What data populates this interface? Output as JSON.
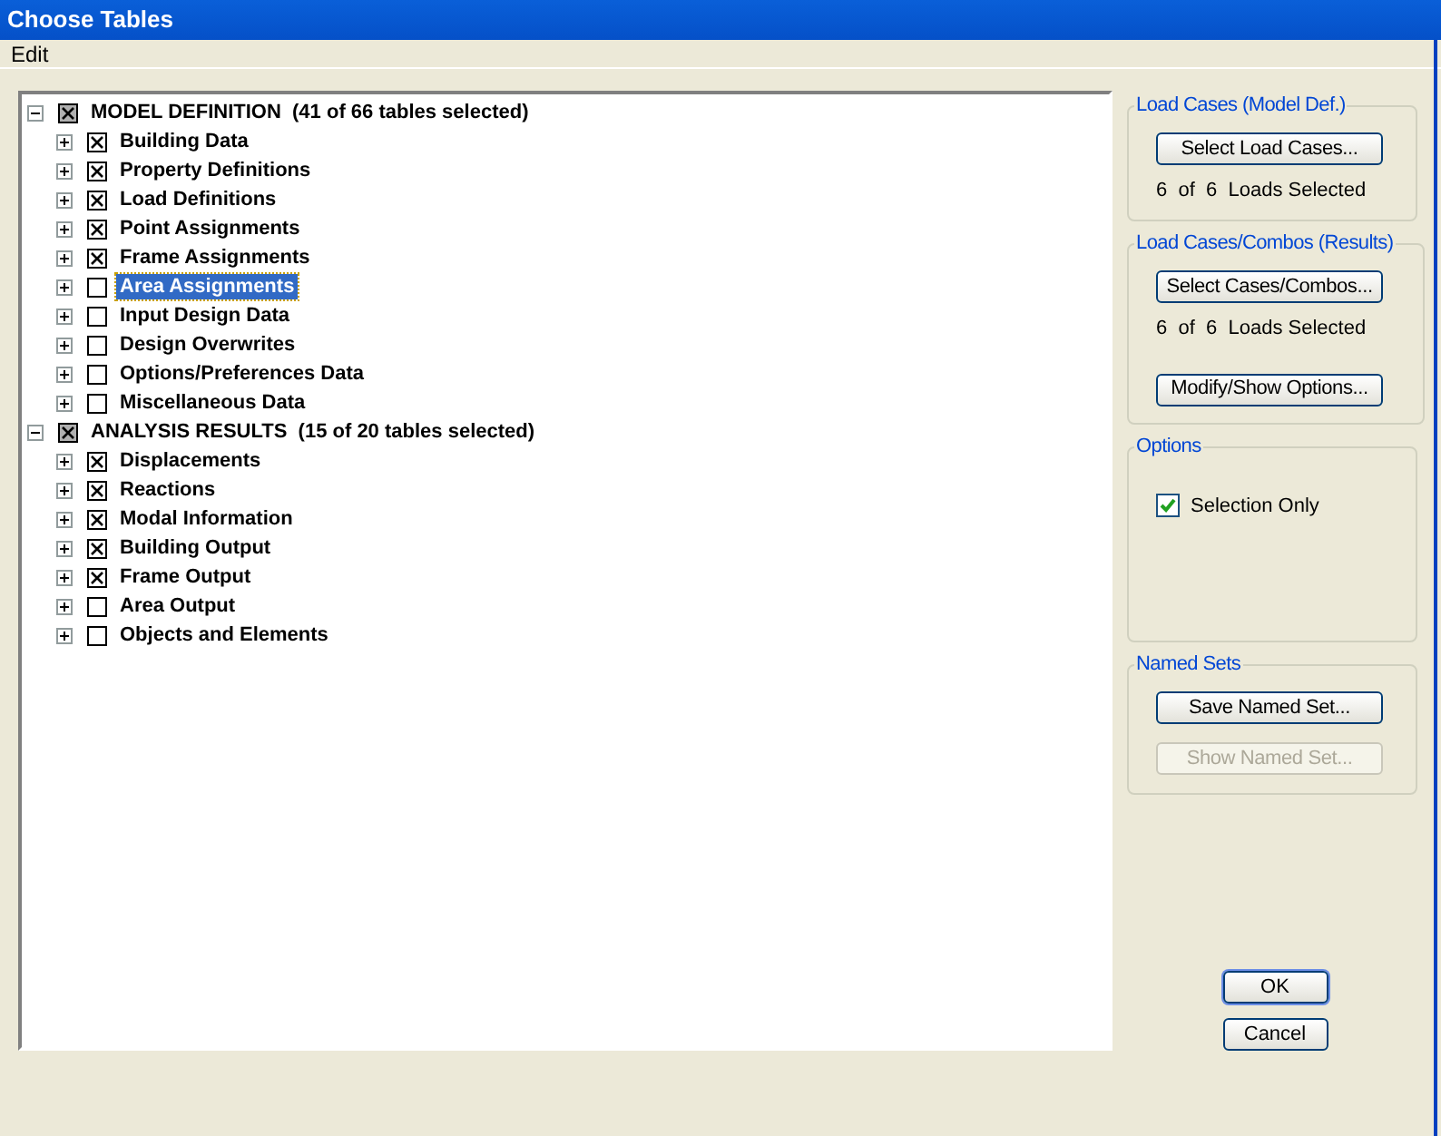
{
  "window": {
    "title": "Choose Tables"
  },
  "menu": [
    "Edit"
  ],
  "tree": [
    {
      "label": "MODEL DEFINITION  (41 of 66 tables selected)",
      "checked": true,
      "partial": true,
      "expanded": true,
      "selected": false,
      "children": [
        {
          "label": "Building Data",
          "checked": true,
          "selected": false,
          "expanded": false
        },
        {
          "label": "Property Definitions",
          "checked": true,
          "selected": false,
          "expanded": false
        },
        {
          "label": "Load Definitions",
          "checked": true,
          "selected": false,
          "expanded": false
        },
        {
          "label": "Point Assignments",
          "checked": true,
          "selected": false,
          "expanded": false
        },
        {
          "label": "Frame Assignments",
          "checked": true,
          "selected": false,
          "expanded": false
        },
        {
          "label": "Area Assignments",
          "checked": false,
          "selected": true,
          "expanded": false
        },
        {
          "label": "Input Design Data",
          "checked": false,
          "selected": false,
          "expanded": false
        },
        {
          "label": "Design Overwrites",
          "checked": false,
          "selected": false,
          "expanded": false
        },
        {
          "label": "Options/Preferences Data",
          "checked": false,
          "selected": false,
          "expanded": false
        },
        {
          "label": "Miscellaneous Data",
          "checked": false,
          "selected": false,
          "expanded": false
        }
      ]
    },
    {
      "label": "ANALYSIS RESULTS  (15 of 20 tables selected)",
      "checked": true,
      "partial": true,
      "expanded": true,
      "selected": false,
      "children": [
        {
          "label": "Displacements",
          "checked": true,
          "selected": false,
          "expanded": false
        },
        {
          "label": "Reactions",
          "checked": true,
          "selected": false,
          "expanded": false
        },
        {
          "label": "Modal Information",
          "checked": true,
          "selected": false,
          "expanded": false
        },
        {
          "label": "Building Output",
          "checked": true,
          "selected": false,
          "expanded": false
        },
        {
          "label": "Frame Output",
          "checked": true,
          "selected": false,
          "expanded": false
        },
        {
          "label": "Area Output",
          "checked": false,
          "selected": false,
          "expanded": false
        },
        {
          "label": "Objects and Elements",
          "checked": false,
          "selected": false,
          "expanded": false
        }
      ]
    }
  ],
  "groups": [
    {
      "title": "Load Cases (Model Def.)",
      "items": [
        {
          "kind": "button",
          "label": "Select Load Cases...",
          "disabled": false
        },
        {
          "kind": "text",
          "label": "6  of  6  Loads Selected"
        }
      ]
    },
    {
      "title": "Load Cases/Combos (Results)",
      "items": [
        {
          "kind": "button",
          "label": "Select Cases/Combos...",
          "disabled": false
        },
        {
          "kind": "text",
          "label": "6  of  6  Loads Selected"
        },
        {
          "kind": "button",
          "label": "Modify/Show Options...",
          "disabled": false
        }
      ]
    },
    {
      "title": "Options",
      "items": [
        {
          "kind": "checkbox",
          "label": "Selection Only",
          "checked": true
        }
      ]
    },
    {
      "title": "Named Sets",
      "items": [
        {
          "kind": "button",
          "label": "Save Named Set...",
          "disabled": false
        },
        {
          "kind": "button",
          "label": "Show Named Set...",
          "disabled": true
        }
      ]
    }
  ],
  "buttons": [
    {
      "label": "OK",
      "default": true
    },
    {
      "label": "Cancel",
      "default": false
    }
  ]
}
